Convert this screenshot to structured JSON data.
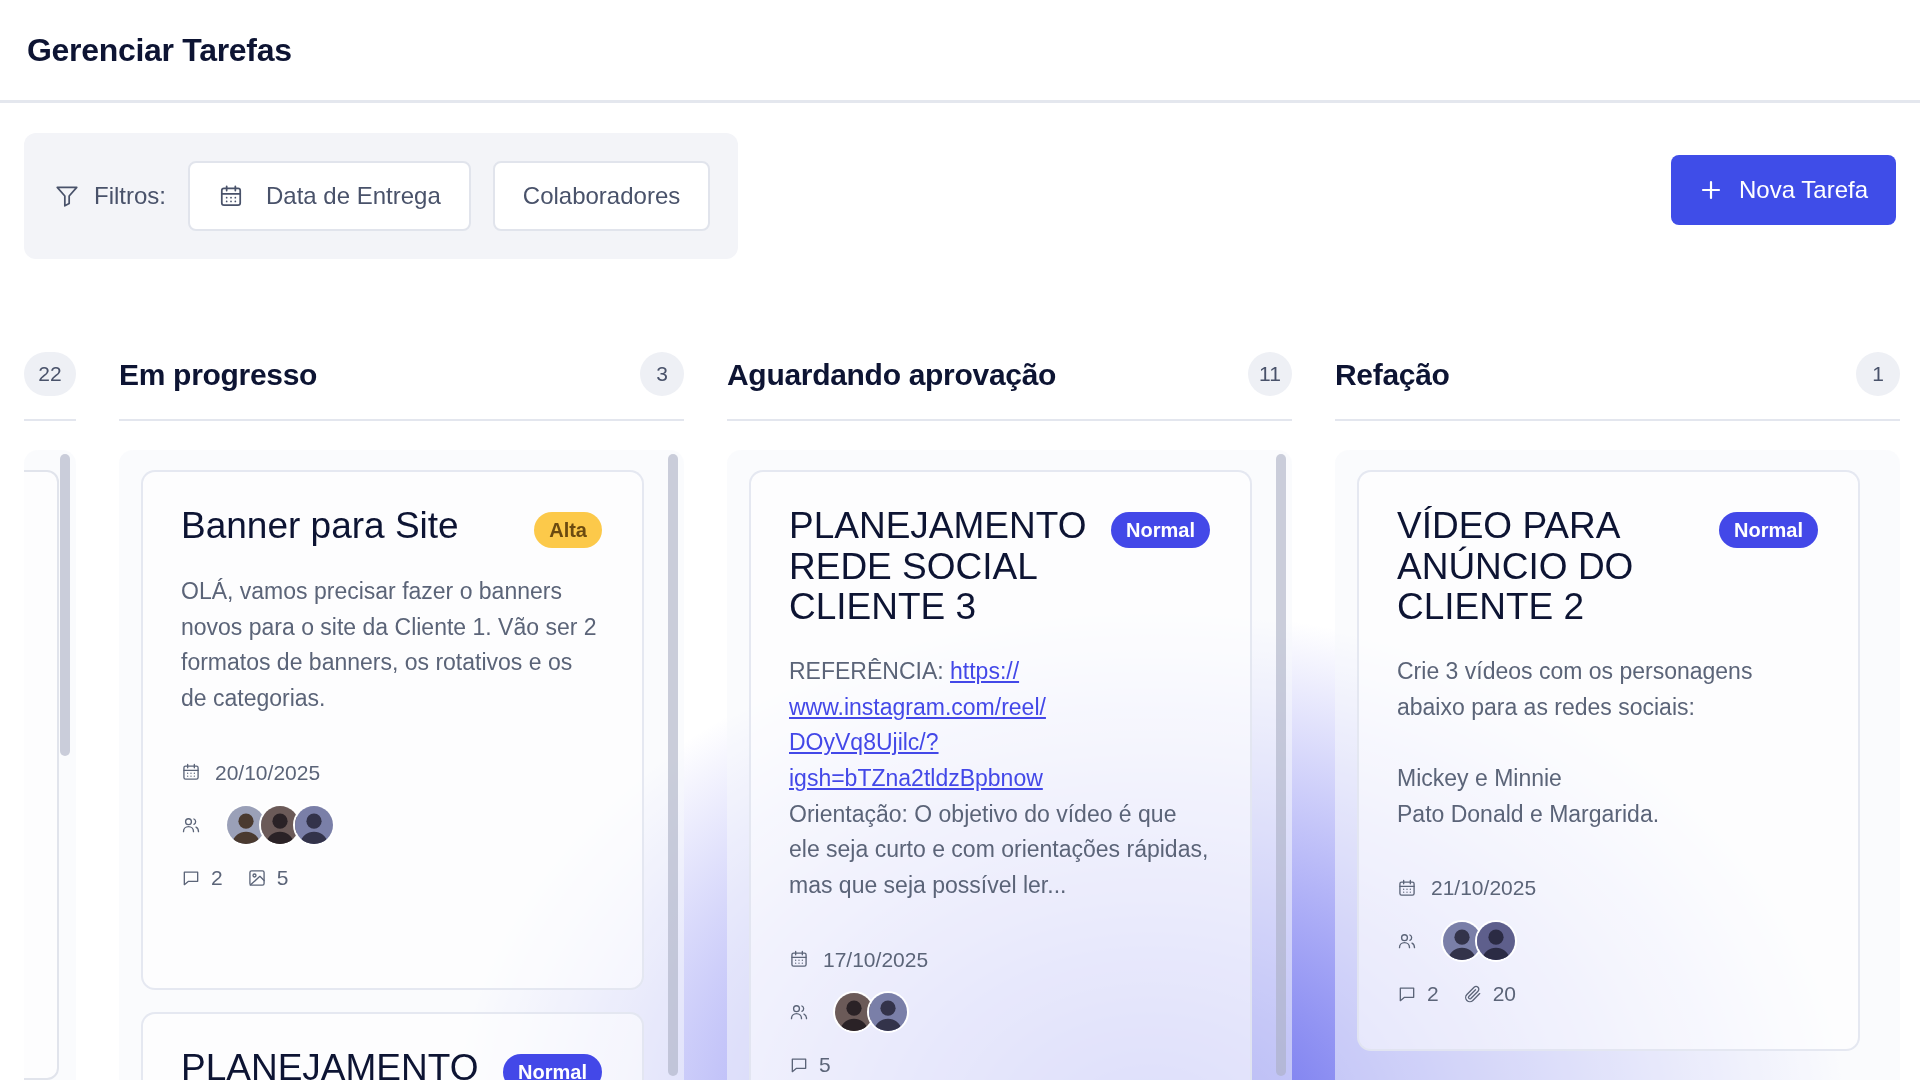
{
  "page": {
    "title": "Gerenciar Tarefas"
  },
  "filters": {
    "label": "Filtros:",
    "buttons": [
      {
        "kind": "date",
        "label": "Data de Entrega"
      },
      {
        "kind": "people",
        "label": "Colaboradores"
      }
    ]
  },
  "new_task_button": {
    "label": "Nova Tarefa"
  },
  "columns": [
    {
      "count": "22",
      "cut_off": true
    },
    {
      "title": "Em progresso",
      "count": "3",
      "cards": [
        {
          "title": "Banner para Site",
          "badge": {
            "label": "Alta",
            "color": "#fcc94a"
          },
          "description": [
            [
              {
                "kind": "text",
                "text": "OLÁ, vamos precisar fazer o banners novos para o site da Cliente 1. Vão ser 2 formatos de banners, os rotativos e os de categorias."
              }
            ]
          ],
          "date": "20/10/2025",
          "avatars": [
            {
              "kind": "picture"
            },
            {
              "kind": "picture"
            },
            {
              "kind": "picture"
            }
          ],
          "stats": [
            {
              "kind": "comments",
              "count": "2"
            },
            {
              "kind": "images",
              "count": "5"
            }
          ]
        },
        {
          "title": "PLANEJAMENTO",
          "badge": {
            "label": "Normal",
            "color": "#4348e8"
          }
        }
      ]
    },
    {
      "title": "Aguardando aprovação",
      "count": "11",
      "cards": [
        {
          "title": "PLANEJAMENTO REDE SOCIAL CLIENTE 3",
          "badge": {
            "label": "Normal",
            "color": "#4348e8"
          },
          "description": [
            [
              {
                "kind": "text",
                "text": "REFERÊNCIA: "
              },
              {
                "kind": "link",
                "text": "https://"
              },
              {
                "kind": "link",
                "text": "www.instagram.com/reel/"
              },
              {
                "kind": "link",
                "text": "DOyVq8Ujilc/?"
              },
              {
                "kind": "link",
                "text": "igsh=bTZna2tldzBpbnow"
              }
            ],
            [
              {
                "kind": "text",
                "text": "Orientação: O objetivo do vídeo é que ele seja curto e com orientações rápidas, mas que seja possível ler..."
              }
            ]
          ],
          "date": "17/10/2025",
          "avatars": [
            {
              "kind": "picture"
            },
            {
              "kind": "picture"
            }
          ],
          "stats": [
            {
              "kind": "comments",
              "count": "5"
            }
          ]
        }
      ]
    },
    {
      "title": "Refação",
      "count": "1",
      "cards": [
        {
          "title": "VÍDEO PARA ANÚNCIO DO CLIENTE 2",
          "badge": {
            "label": "Normal",
            "color": "#4348e8"
          },
          "description": [
            [
              {
                "kind": "text",
                "text": "Crie 3 vídeos com os personagens abaixo para as redes sociais:\n\nMickey e Minnie\nPato Donald e Margarida."
              }
            ]
          ],
          "date": "21/10/2025",
          "avatars": [
            {
              "kind": "picture"
            },
            {
              "kind": "picture"
            }
          ],
          "stats": [
            {
              "kind": "comments",
              "count": "2"
            },
            {
              "kind": "attachments",
              "count": "20"
            }
          ]
        }
      ]
    }
  ]
}
